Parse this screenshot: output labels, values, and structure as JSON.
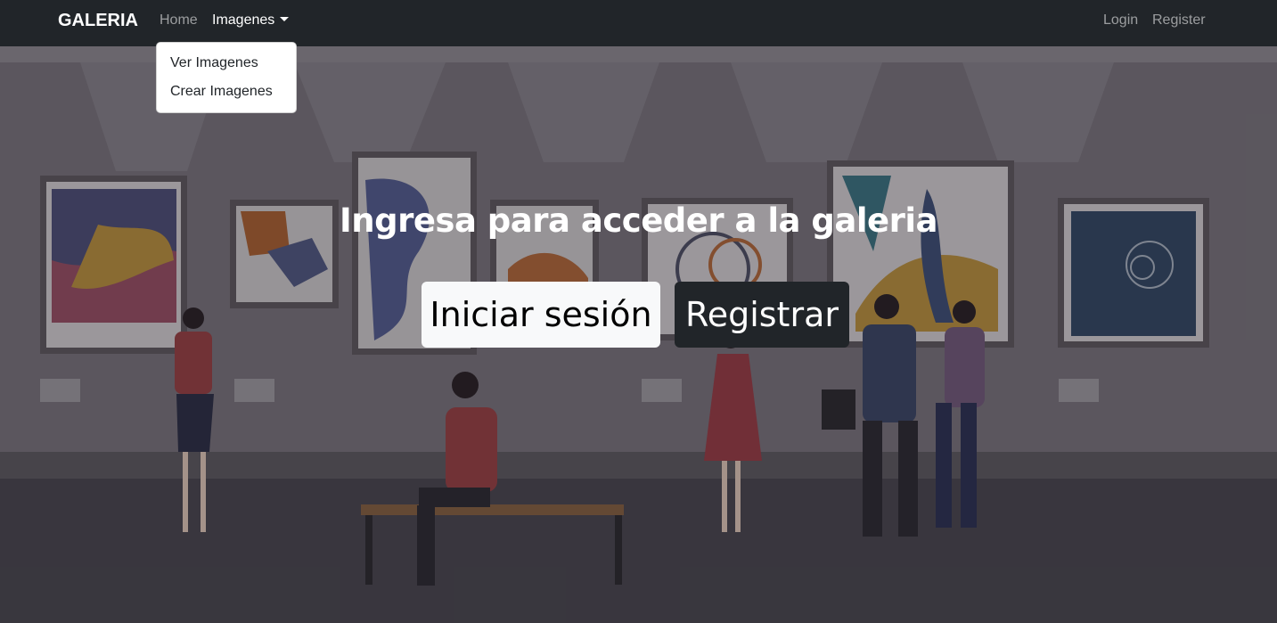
{
  "navbar": {
    "brand": "GALERIA",
    "home": "Home",
    "imagenes": "Imagenes",
    "login": "Login",
    "register": "Register"
  },
  "dropdown": {
    "items": [
      "Ver Imagenes",
      "Crear Imagenes"
    ]
  },
  "hero": {
    "title": "Ingresa para acceder a la galeria",
    "login_button": "Iniciar sesión",
    "register_button": "Registrar"
  },
  "colors": {
    "navbar_bg": "#212529",
    "btn_light": "#f8f9fa",
    "btn_dark": "#212529"
  }
}
